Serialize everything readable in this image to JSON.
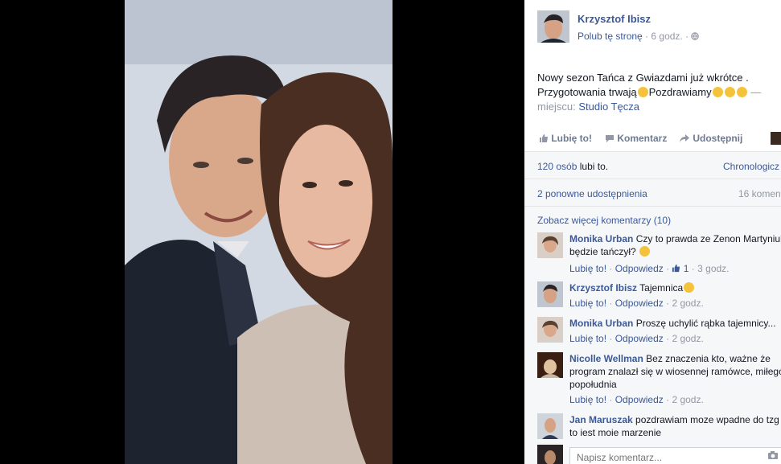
{
  "post": {
    "author": "Krzysztof Ibisz",
    "like_page": "Polub tę stronę",
    "dot": "·",
    "time": "6 godz.",
    "text_line1": "Nowy sezon Tańca z Gwiazdami już wkrótce .",
    "text_line2a": "Przygotowania trwają",
    "text_line2b": "Pozdrawiamy",
    "dash": "—",
    "location_prefix": "miejscu:",
    "location": "Studio Tęcza"
  },
  "actions": {
    "like": "Lubię to!",
    "comment": "Komentarz",
    "share": "Udostępnij"
  },
  "stats": {
    "likes_count": "120 osób",
    "likes_suffix": "lubi to.",
    "sort": "Chronologicz",
    "shares": "2 ponowne udostępnienia",
    "comments_count": "16 komen"
  },
  "more_comments": "Zobacz więcej komentarzy (10)",
  "comments": [
    {
      "name": "Monika Urban",
      "text": "Czy to prawda ze Zenon Martyniuk będzie tańczył?",
      "like": "Lubię to!",
      "reply": "Odpowiedz",
      "likes": "1",
      "time": "3 godz."
    },
    {
      "name": "Krzysztof Ibisz",
      "text": "Tajemnica",
      "like": "Lubię to!",
      "reply": "Odpowiedz",
      "time": "2 godz."
    },
    {
      "name": "Monika Urban",
      "text": "Proszę uchylić rąbka tajemnicy...",
      "like": "Lubię to!",
      "reply": "Odpowiedz",
      "time": "2 godz."
    },
    {
      "name": "Nicolle Wellman",
      "text": "Bez znaczenia kto, ważne że program znalazł się w wiosennej ramówce, miłego popołudnia",
      "like": "Lubię to!",
      "reply": "Odpowiedz",
      "time": "2 godz."
    },
    {
      "name": "Jan Maruszak",
      "text": "pozdrawiam moze wpadne do tzg to iest moie marzenie"
    }
  ],
  "input": {
    "placeholder": "Napisz komentarz..."
  },
  "colors": {
    "link": "#3b5998",
    "muted": "#9197a3",
    "background": "#000000"
  }
}
